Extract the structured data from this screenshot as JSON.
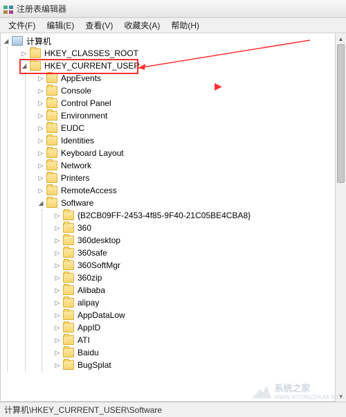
{
  "window": {
    "title": "注册表编辑器"
  },
  "menu": {
    "file": "文件(F)",
    "edit": "编辑(E)",
    "view": "查看(V)",
    "favorites": "收藏夹(A)",
    "help": "帮助(H)"
  },
  "tree": {
    "root": "计算机",
    "hives": {
      "classes_root": "HKEY_CLASSES_ROOT",
      "current_user": "HKEY_CURRENT_USER"
    },
    "hkcu_children": [
      "AppEvents",
      "Console",
      "Control Panel",
      "Environment",
      "EUDC",
      "Identities",
      "Keyboard Layout",
      "Network",
      "Printers",
      "RemoteAccess",
      "Software"
    ],
    "software_children": [
      "{B2CB09FF-2453-4f85-9F40-21C05BE4CBA8}",
      "360",
      "360desktop",
      "360safe",
      "360SoftMgr",
      "360zip",
      "Alibaba",
      "alipay",
      "AppDataLow",
      "AppID",
      "ATI",
      "Baidu",
      "BugSplat"
    ]
  },
  "statusbar": {
    "path": "计算机\\HKEY_CURRENT_USER\\Software"
  },
  "watermark": {
    "text": "系统之家",
    "url": "WWW.XITONGZHIJIA.NET"
  }
}
